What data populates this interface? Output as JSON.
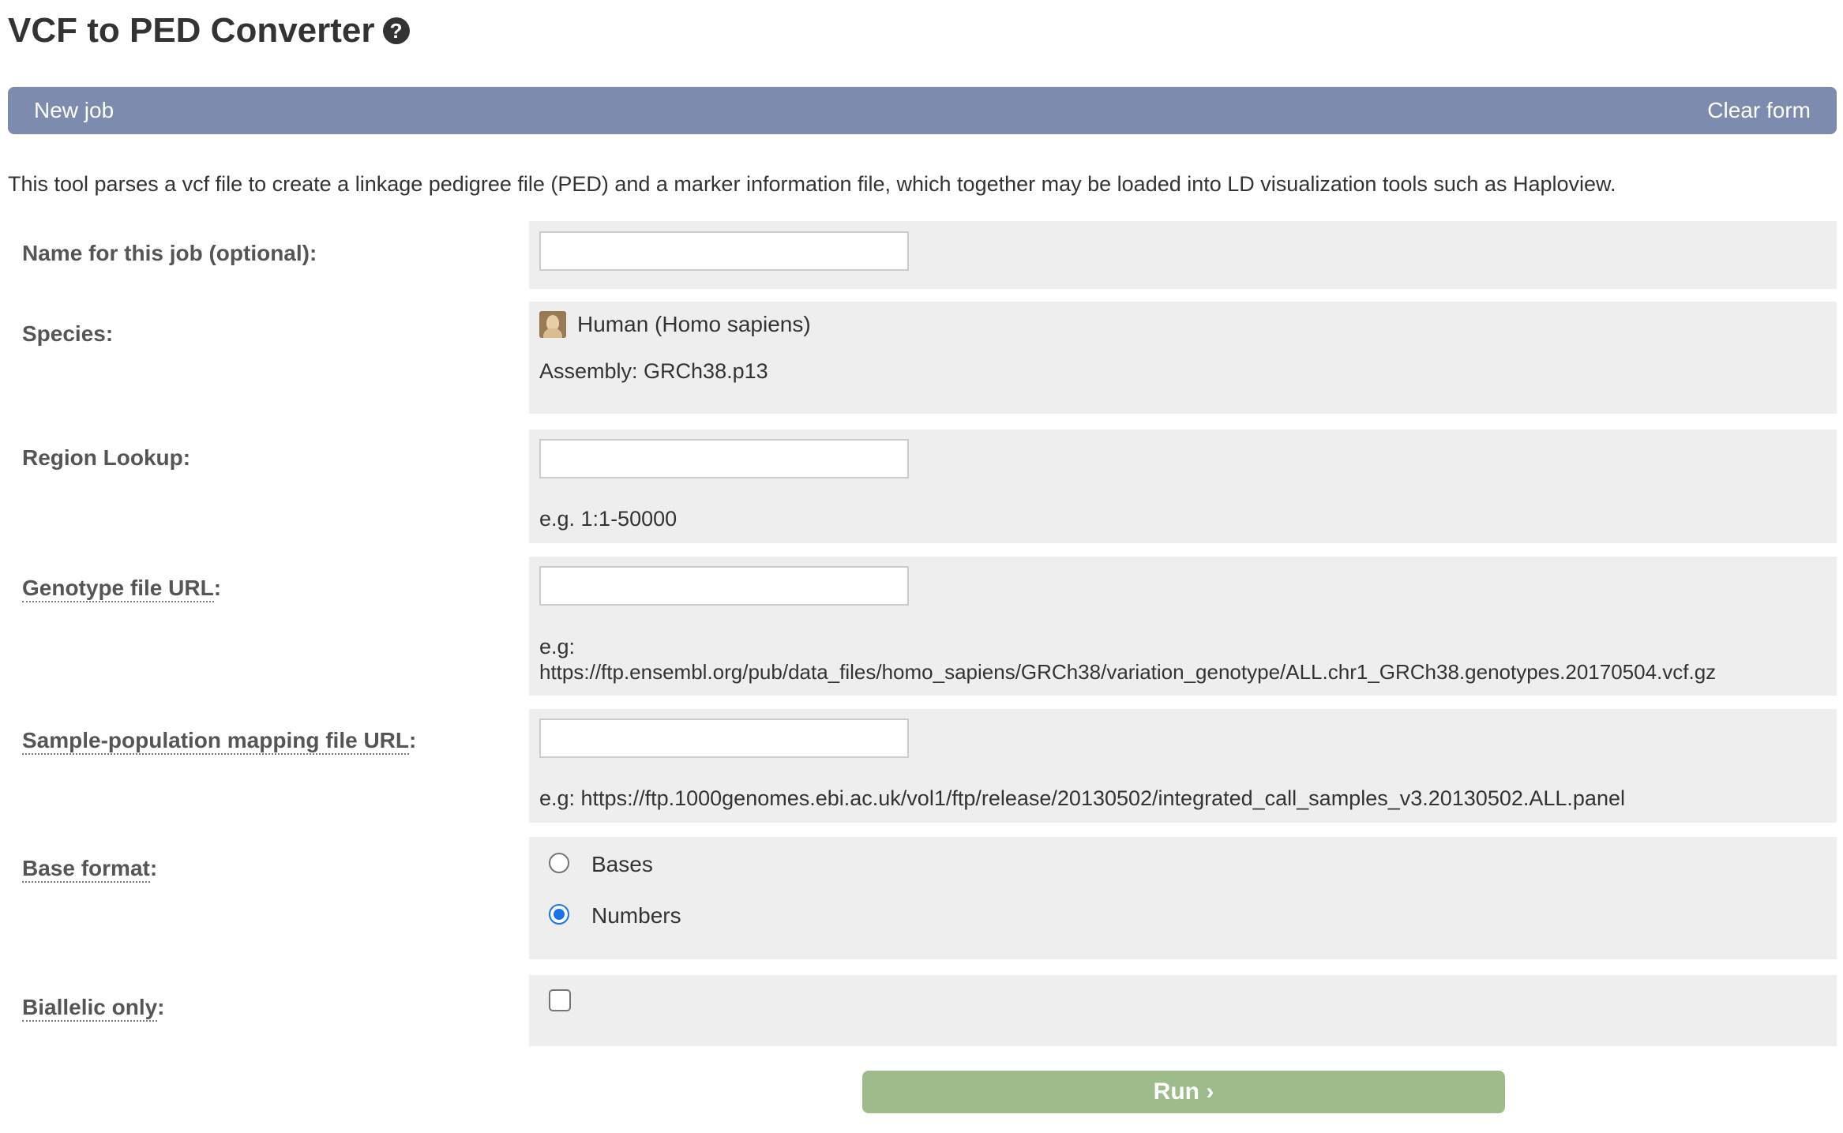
{
  "header": {
    "title": "VCF to PED Converter",
    "help_icon": "question-circle-icon"
  },
  "navbar": {
    "new_job": "New job",
    "clear_form": "Clear form",
    "color": "#7d8cae"
  },
  "description": "This tool parses a vcf file to create a linkage pedigree file (PED) and a marker information file, which together may be loaded into LD visualization tools such as Haploview.",
  "form": {
    "job_name": {
      "label": "Name for this job (optional):",
      "value": ""
    },
    "species": {
      "label": "Species:",
      "name": "Human (Homo sapiens)",
      "assembly": "Assembly: GRCh38.p13",
      "icon": "human-species-icon"
    },
    "region": {
      "label": "Region Lookup:",
      "value": "",
      "hint": "e.g. 1:1-50000"
    },
    "genotype_url": {
      "label": "Genotype file URL:",
      "value": "",
      "hint_prefix": "e.g:",
      "hint_url": "https://ftp.ensembl.org/pub/data_files/homo_sapiens/GRCh38/variation_genotype/ALL.chr1_GRCh38.genotypes.20170504.vcf.gz"
    },
    "sample_population": {
      "label": "Sample-population mapping file URL:",
      "value": "",
      "hint": "e.g: https://ftp.1000genomes.ebi.ac.uk/vol1/ftp/release/20130502/integrated_call_samples_v3.20130502.ALL.panel"
    },
    "base_format": {
      "label": "Base format:",
      "options": [
        {
          "label": "Bases",
          "checked": false
        },
        {
          "label": "Numbers",
          "checked": true
        }
      ]
    },
    "biallelic": {
      "label": "Biallelic only:",
      "checked": false
    }
  },
  "run_button": {
    "label": "Run ›",
    "color": "#9ebb8b"
  }
}
